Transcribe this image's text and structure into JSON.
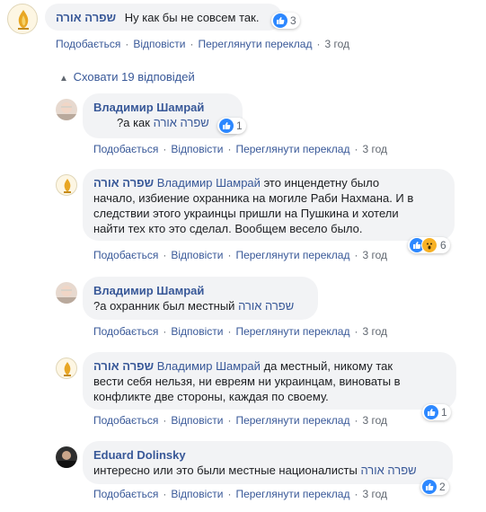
{
  "colors": {
    "link": "#385898",
    "bubble": "#f2f3f5",
    "like": "#2d88ff",
    "wow": "#f7b125",
    "muted": "#606770"
  },
  "actions": {
    "like": "Подобається",
    "reply": "Відповісти",
    "translate": "Переглянути переклад"
  },
  "top_comment": {
    "author": "שפרה אורה",
    "text": "Ну как бы не совсем так.",
    "reaction_count": "3",
    "time": "3 год"
  },
  "hide_replies_label": "Сховати 19 відповідей",
  "replies": [
    {
      "author": "Владимир Шамрай",
      "mention": "שפרה אורה",
      "text_before": "?а как",
      "text_after": "",
      "reaction_count": "1",
      "time": "3 год"
    },
    {
      "author": "שפרה אורה",
      "mention": "Владимир Шамрай",
      "text_line1_after": "это инцендетну было",
      "text_line2": "начало, избиение охранника на могиле Раби Нахмана. И в",
      "text_line3": "следствии этого украинцы пришли на Пушкина и хотели",
      "text_line4": "найти тех кто это сделал. Вообщем весело было.",
      "reaction_count": "6",
      "time": "3 год"
    },
    {
      "author": "Владимир Шамрай",
      "mention": "שפרה אורה",
      "text_before": "?а охранник был местный",
      "time": "3 год"
    },
    {
      "author": "שפרה אורה",
      "mention": "Владимир Шамрай",
      "text_line1_after": "да местный, никому так",
      "text_line2": "вести себя нельзя, ни евреям ни украинцам, виноваты в",
      "text_line3": "конфликте две стороны, каждая по своему.",
      "reaction_count": "1",
      "time": "3 год"
    },
    {
      "author": "Eduard Dolinsky",
      "mention": "שפרה אורה",
      "text_before": "интересно или это были местные националисты",
      "reaction_count": "2",
      "time": "3 год"
    }
  ]
}
